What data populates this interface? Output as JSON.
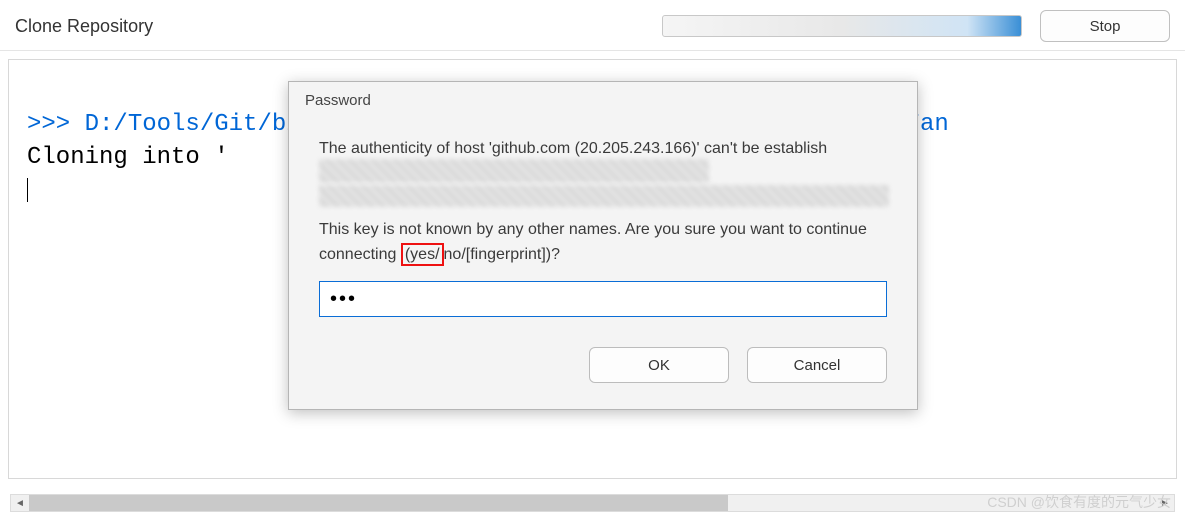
{
  "header": {
    "title": "Clone Repository",
    "stop_label": "Stop"
  },
  "terminal": {
    "prompt": ">>> ",
    "command": "D:/Tools/Git/bin/git.exe clone --progress git@github.com:Fan",
    "output": "Cloning into '"
  },
  "dialog": {
    "title": "Password",
    "message_top": "The authenticity of host 'github.com (20.205.243.166)' can't be establish",
    "message_bottom_before": "This key is not known by any other names. Are you sure you want to continue connecting ",
    "message_highlight": "(yes/",
    "message_bottom_after": "no/[fingerprint])?",
    "password_value": "•••",
    "ok_label": "OK",
    "cancel_label": "Cancel"
  },
  "watermark": "CSDN @饮食有度的元气少女"
}
